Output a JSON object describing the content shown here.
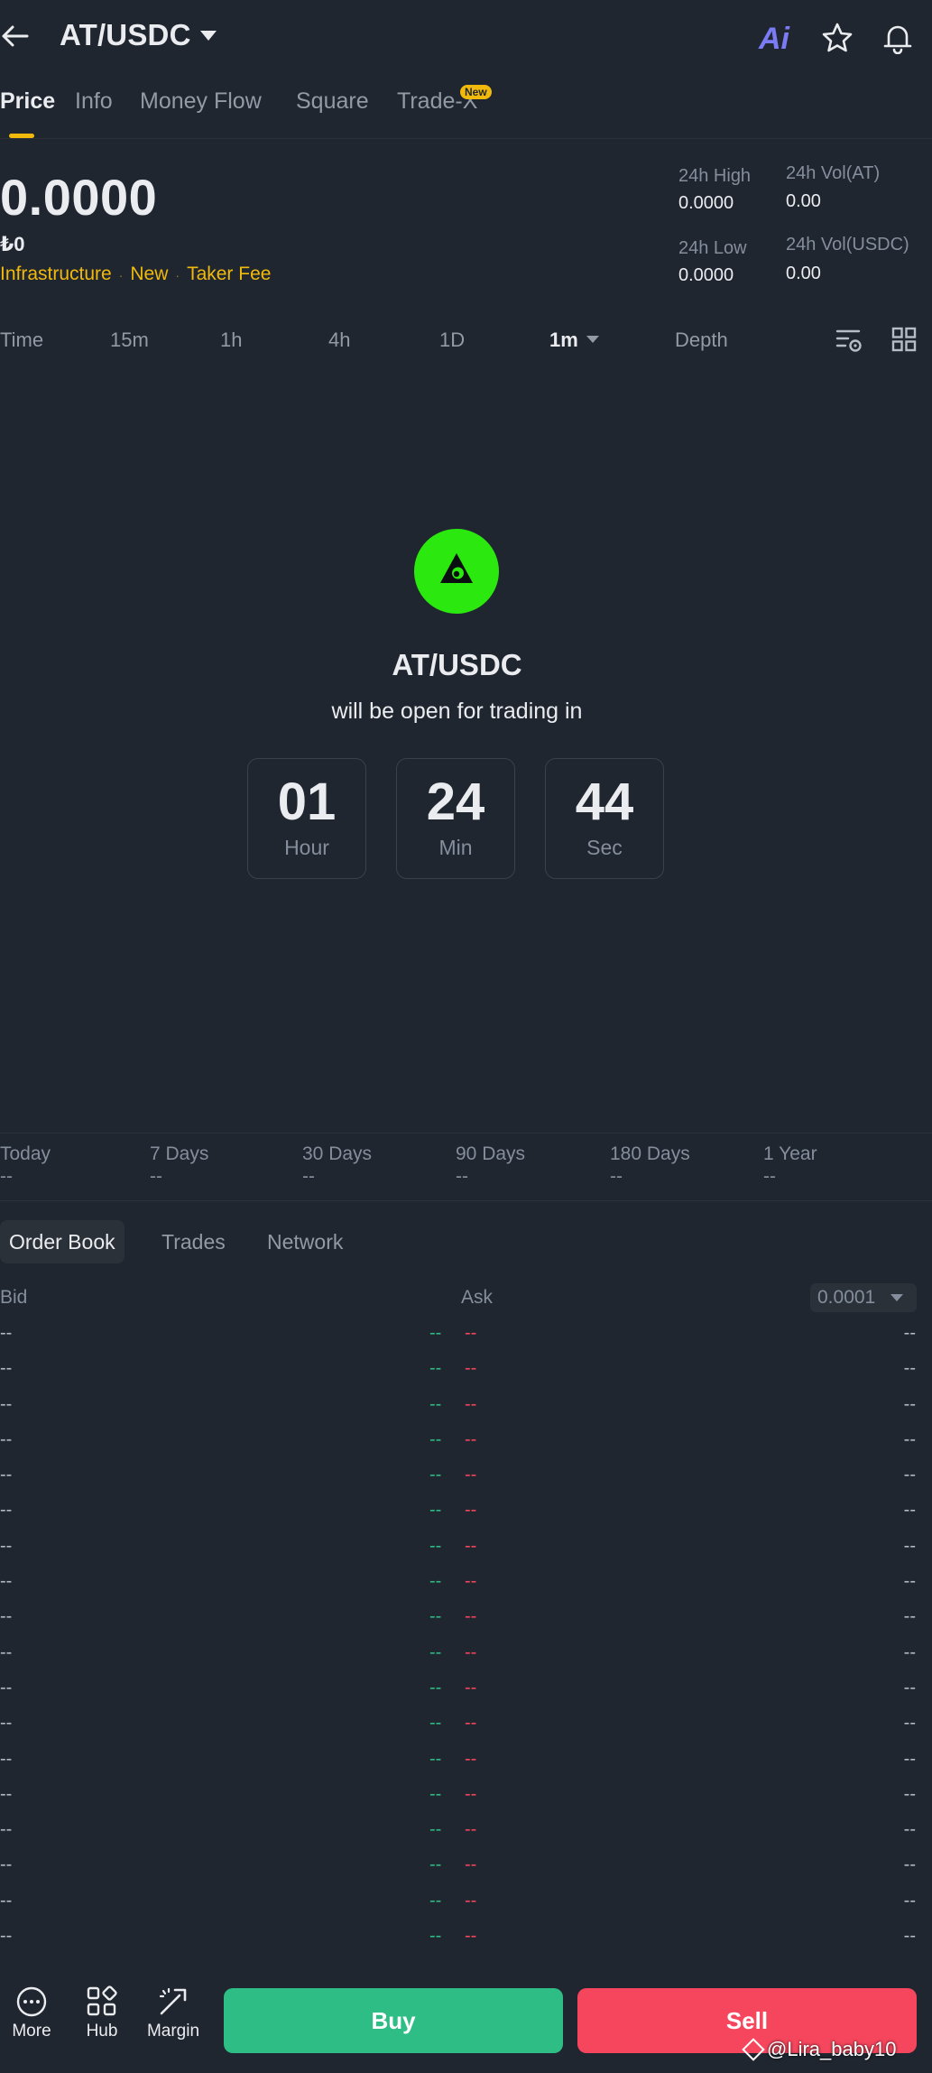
{
  "header": {
    "pair": "AT/USDC",
    "ai_label": "Ai"
  },
  "tabs": [
    {
      "label": "Price",
      "active": true
    },
    {
      "label": "Info"
    },
    {
      "label": "Money Flow"
    },
    {
      "label": "Square"
    },
    {
      "label": "Trade-X",
      "badge": "New"
    }
  ],
  "price": {
    "last": "0.0000",
    "fiat": "₺0",
    "tags": [
      "Infrastructure",
      "New",
      "Taker Fee"
    ],
    "stats": {
      "high_label": "24h High",
      "high_value": "0.0000",
      "vol_base_label": "24h Vol(AT)",
      "vol_base_value": "0.00",
      "low_label": "24h Low",
      "low_value": "0.0000",
      "vol_quote_label": "24h Vol(USDC)",
      "vol_quote_value": "0.00"
    }
  },
  "intervals": [
    {
      "label": "Time"
    },
    {
      "label": "15m"
    },
    {
      "label": "1h"
    },
    {
      "label": "4h"
    },
    {
      "label": "1D"
    },
    {
      "label": "1m",
      "active": true
    },
    {
      "label": "Depth"
    }
  ],
  "countdown": {
    "pair": "AT/USDC",
    "subtitle": "will be open for trading in",
    "hours": "01",
    "hours_label": "Hour",
    "minutes": "24",
    "minutes_label": "Min",
    "seconds": "44",
    "seconds_label": "Sec",
    "logo_color": "#2BE80F"
  },
  "performance": [
    {
      "label": "Today",
      "value": "--"
    },
    {
      "label": "7 Days",
      "value": "--"
    },
    {
      "label": "30 Days",
      "value": "--"
    },
    {
      "label": "90 Days",
      "value": "--"
    },
    {
      "label": "180 Days",
      "value": "--"
    },
    {
      "label": "1 Year",
      "value": "--"
    }
  ],
  "order_book": {
    "tabs": [
      "Order Book",
      "Trades",
      "Network"
    ],
    "bid_label": "Bid",
    "ask_label": "Ask",
    "precision": "0.0001",
    "empty": "--",
    "row_count": 18
  },
  "bottom": {
    "more": "More",
    "hub": "Hub",
    "margin": "Margin",
    "buy": "Buy",
    "sell": "Sell",
    "watermark": "@Lira_baby10"
  },
  "colors": {
    "background": "#202630",
    "accent": "#F0B90B",
    "buy": "#2EBD85",
    "sell": "#F6465D"
  }
}
